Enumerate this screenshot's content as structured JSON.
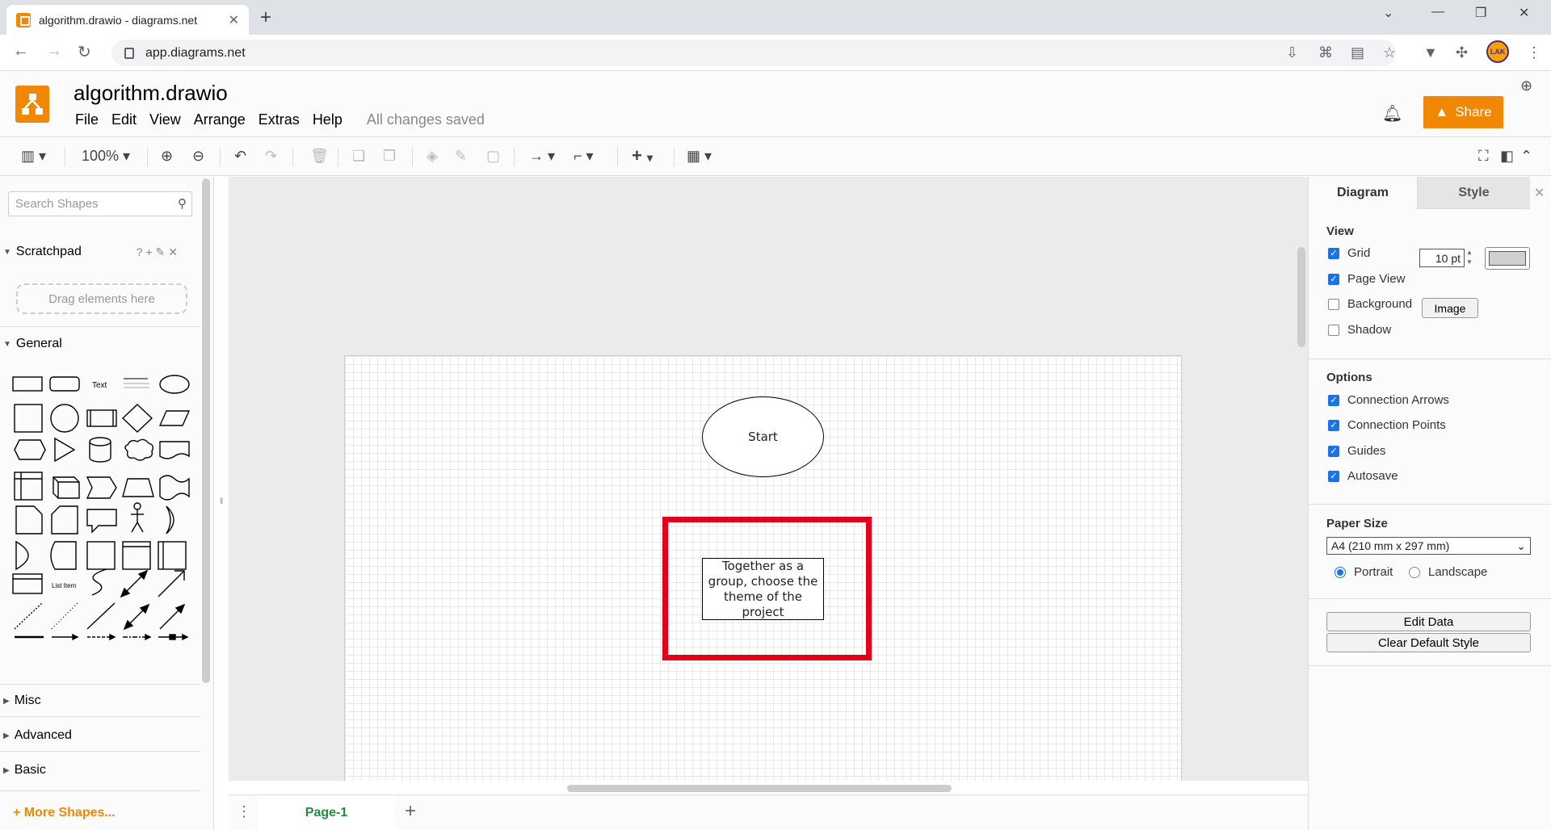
{
  "browser": {
    "tab_title": "algorithm.drawio - diagrams.net",
    "url": "app.diagrams.net"
  },
  "app": {
    "filename": "algorithm.drawio",
    "menu": [
      "File",
      "Edit",
      "View",
      "Arrange",
      "Extras",
      "Help"
    ],
    "save_status": "All changes saved",
    "share_label": "Share"
  },
  "toolbar": {
    "zoom": "100%"
  },
  "sidebar": {
    "search_placeholder": "Search Shapes",
    "scratchpad_label": "Scratchpad",
    "dropzone_text": "Drag elements here",
    "general_label": "General",
    "sections": [
      "Misc",
      "Advanced",
      "Basic"
    ],
    "more_shapes": "More Shapes..."
  },
  "canvas": {
    "start_label": "Start",
    "process_label": "Together as a group, choose the theme of the project",
    "highlight_color": "#e3001b"
  },
  "pages": {
    "current": "Page-1"
  },
  "format_panel": {
    "tab_diagram": "Diagram",
    "tab_style": "Style",
    "view_heading": "View",
    "grid_label": "Grid",
    "grid_size": "10 pt",
    "page_view_label": "Page View",
    "background_label": "Background",
    "image_button": "Image",
    "shadow_label": "Shadow",
    "options_heading": "Options",
    "connection_arrows": "Connection Arrows",
    "connection_points": "Connection Points",
    "guides": "Guides",
    "autosave": "Autosave",
    "paper_size_heading": "Paper Size",
    "paper_size_value": "A4 (210 mm x 297 mm)",
    "portrait": "Portrait",
    "landscape": "Landscape",
    "edit_data": "Edit Data",
    "clear_default_style": "Clear Default Style"
  }
}
